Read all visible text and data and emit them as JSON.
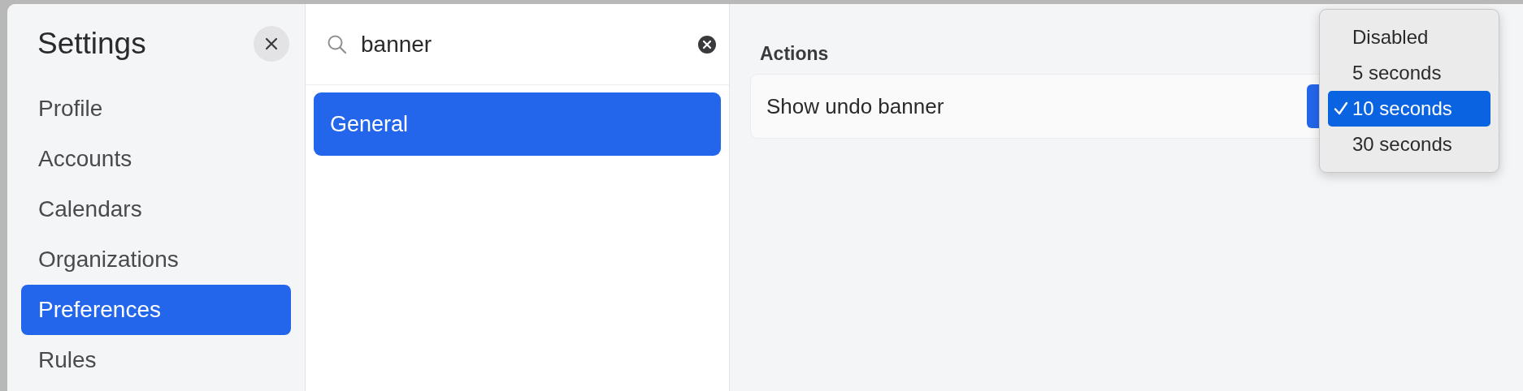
{
  "sidebar": {
    "title": "Settings",
    "items": [
      {
        "label": "Profile",
        "selected": false
      },
      {
        "label": "Accounts",
        "selected": false
      },
      {
        "label": "Calendars",
        "selected": false
      },
      {
        "label": "Organizations",
        "selected": false
      },
      {
        "label": "Preferences",
        "selected": true
      },
      {
        "label": "Rules",
        "selected": false
      }
    ]
  },
  "search": {
    "value": "banner"
  },
  "results": [
    {
      "label": "General",
      "selected": true
    }
  ],
  "section": {
    "title": "Actions",
    "rows": [
      {
        "label": "Show undo banner"
      }
    ]
  },
  "menu": {
    "options": [
      {
        "label": "Disabled",
        "selected": false
      },
      {
        "label": "5 seconds",
        "selected": false
      },
      {
        "label": "10 seconds",
        "selected": true
      },
      {
        "label": "30 seconds",
        "selected": false
      }
    ]
  }
}
